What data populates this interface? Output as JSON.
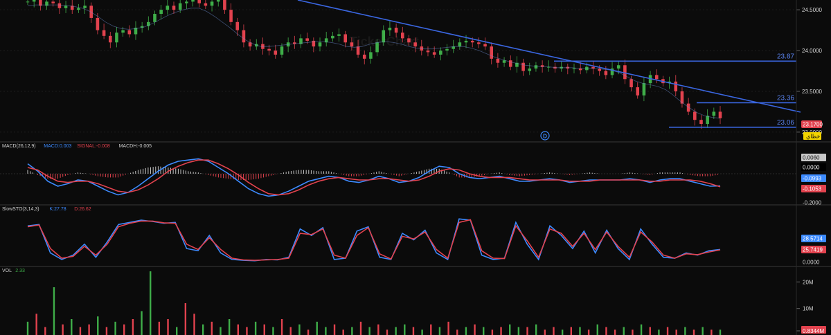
{
  "watermark": "TickerChart",
  "event_marker": "D",
  "chart_data": [
    {
      "type": "candlestick",
      "name": "price",
      "yticks": [
        "24.5000",
        "24.0000",
        "23.5000",
        "23.0000"
      ],
      "ylim": [
        22.88,
        24.62
      ],
      "last_price": "23.1700",
      "badge_text": "خطاي",
      "horizontal_lines": [
        {
          "label": "23.87",
          "value": 23.87
        },
        {
          "label": "23.36",
          "value": 23.36
        },
        {
          "label": "23.06",
          "value": 23.06
        }
      ],
      "closes": [
        24.6,
        24.62,
        24.55,
        24.6,
        24.58,
        24.52,
        24.55,
        24.5,
        24.52,
        24.55,
        24.4,
        24.25,
        24.18,
        24.1,
        24.22,
        24.25,
        24.2,
        24.28,
        24.3,
        24.35,
        24.45,
        24.5,
        24.55,
        24.5,
        24.58,
        24.6,
        24.62,
        24.58,
        24.55,
        24.6,
        24.62,
        24.5,
        24.35,
        24.25,
        24.1,
        24.05,
        24.08,
        24.02,
        24.0,
        23.95,
        24.05,
        24.1,
        24.08,
        24.15,
        24.12,
        24.05,
        24.1,
        24.15,
        24.18,
        24.2,
        24.1,
        24.05,
        23.95,
        23.9,
        23.98,
        24.1,
        24.25,
        24.28,
        24.22,
        24.15,
        24.1,
        24.05,
        24.0,
        23.98,
        23.95,
        24.0,
        24.02,
        24.05,
        24.1,
        24.12,
        24.1,
        24.08,
        24.05,
        23.9,
        23.85,
        23.88,
        23.8,
        23.85,
        23.75,
        23.78,
        23.82,
        23.8,
        23.8,
        23.78,
        23.8,
        23.78,
        23.78,
        23.76,
        23.8,
        23.78,
        23.75,
        23.7,
        23.78,
        23.82,
        23.65,
        23.55,
        23.45,
        23.6,
        23.7,
        23.65,
        23.6,
        23.62,
        23.5,
        23.35,
        23.25,
        23.15,
        23.1,
        23.2,
        23.25,
        23.17
      ],
      "ma": [
        24.55,
        24.56,
        24.56,
        24.56,
        24.56,
        24.55,
        24.54,
        24.52,
        24.48,
        24.42,
        24.35,
        24.3,
        24.27,
        24.26,
        24.27,
        24.29,
        24.33,
        24.38,
        24.43,
        24.47,
        24.5,
        24.52,
        24.52,
        24.48,
        24.42,
        24.35,
        24.28,
        24.2,
        24.13,
        24.08,
        24.05,
        24.05,
        24.06,
        24.07,
        24.08,
        24.09,
        24.1,
        24.11,
        24.11,
        24.1,
        24.08,
        24.05,
        24.04,
        24.05,
        24.08,
        24.1,
        24.11,
        24.1,
        24.08,
        24.05,
        24.03,
        24.02,
        24.02,
        24.03,
        24.04,
        24.05,
        24.05,
        24.03,
        24.0,
        23.96,
        23.92,
        23.89,
        23.86,
        23.84,
        23.82,
        23.81,
        23.8,
        23.8,
        23.79,
        23.79,
        23.79,
        23.78,
        23.78,
        23.78,
        23.77,
        23.76,
        23.73,
        23.68,
        23.63,
        23.6,
        23.58,
        23.56,
        23.52,
        23.45,
        23.37,
        23.3,
        23.24,
        23.2,
        23.18,
        23.17
      ]
    },
    {
      "type": "bar+line",
      "name": "MACD(26,12,9)",
      "legend": [
        {
          "label": "MACD(26,12,9)",
          "color": "#d0d0d0"
        },
        {
          "label": "MACD:0.003",
          "color": "#3d8bff"
        },
        {
          "label": "SIGNAL:-0.008",
          "color": "#e2424e"
        },
        {
          "label": "MACDH:-0.005",
          "color": "#d0d0d0"
        }
      ],
      "yticks": [
        "0.0060",
        "0.0000",
        "-0.0993",
        "-0.1053",
        "-0.2000"
      ],
      "ylim": [
        -0.22,
        0.12
      ],
      "macd": [
        0.08,
        0.02,
        -0.06,
        -0.1,
        -0.08,
        -0.05,
        -0.06,
        -0.1,
        -0.14,
        -0.17,
        -0.15,
        -0.1,
        -0.04,
        0.02,
        0.07,
        0.1,
        0.11,
        0.12,
        0.1,
        0.05,
        0.0,
        -0.06,
        -0.12,
        -0.16,
        -0.18,
        -0.17,
        -0.14,
        -0.1,
        -0.06,
        -0.04,
        -0.02,
        -0.03,
        -0.06,
        -0.07,
        -0.05,
        -0.02,
        -0.04,
        -0.07,
        -0.06,
        -0.03,
        0.02,
        0.06,
        0.05,
        0.0,
        -0.03,
        -0.04,
        -0.03,
        -0.02,
        -0.04,
        -0.06,
        -0.06,
        -0.05,
        -0.04,
        -0.05,
        -0.07,
        -0.06,
        -0.05,
        -0.05,
        -0.05,
        -0.05,
        -0.04,
        -0.05,
        -0.07,
        -0.05,
        -0.04,
        -0.04,
        -0.06,
        -0.08,
        -0.1,
        -0.098
      ],
      "signal": [
        0.05,
        0.03,
        -0.02,
        -0.06,
        -0.07,
        -0.06,
        -0.06,
        -0.08,
        -0.11,
        -0.14,
        -0.15,
        -0.13,
        -0.09,
        -0.04,
        0.02,
        0.06,
        0.09,
        0.11,
        0.11,
        0.08,
        0.04,
        -0.01,
        -0.07,
        -0.12,
        -0.16,
        -0.17,
        -0.16,
        -0.13,
        -0.09,
        -0.06,
        -0.04,
        -0.03,
        -0.04,
        -0.05,
        -0.05,
        -0.04,
        -0.04,
        -0.05,
        -0.06,
        -0.05,
        -0.02,
        0.02,
        0.04,
        0.03,
        0.0,
        -0.02,
        -0.03,
        -0.03,
        -0.03,
        -0.04,
        -0.05,
        -0.05,
        -0.05,
        -0.05,
        -0.06,
        -0.06,
        -0.06,
        -0.05,
        -0.05,
        -0.05,
        -0.05,
        -0.05,
        -0.06,
        -0.06,
        -0.05,
        -0.05,
        -0.05,
        -0.06,
        -0.08,
        -0.105
      ],
      "hist": [
        0.03,
        -0.01,
        -0.04,
        -0.04,
        -0.01,
        0.01,
        0.0,
        -0.02,
        -0.03,
        -0.03,
        0.0,
        0.03,
        0.05,
        0.06,
        0.05,
        0.04,
        0.02,
        0.01,
        -0.01,
        -0.03,
        -0.04,
        -0.05,
        -0.05,
        -0.04,
        -0.02,
        0.0,
        0.02,
        0.03,
        0.03,
        0.02,
        0.02,
        0.0,
        -0.02,
        -0.02,
        0.0,
        0.02,
        0.0,
        -0.02,
        0.0,
        0.02,
        0.04,
        0.04,
        0.01,
        -0.03,
        -0.03,
        -0.02,
        0.0,
        0.01,
        -0.01,
        -0.02,
        -0.01,
        0.0,
        0.01,
        0.0,
        -0.01,
        0.0,
        0.01,
        0.0,
        0.0,
        0.0,
        0.01,
        0.0,
        -0.01,
        0.01,
        0.01,
        0.01,
        -0.01,
        -0.02,
        -0.02,
        -0.005
      ]
    },
    {
      "type": "line",
      "name": "SlowSTO(3,14,3)",
      "legend": [
        {
          "label": "SlowSTO(3,14,3)",
          "color": "#d0d0d0"
        },
        {
          "label": "K:27.78",
          "color": "#3d8bff"
        },
        {
          "label": "D:26.62",
          "color": "#e2424e"
        }
      ],
      "yticks": [
        "28.5714",
        "25.7419",
        "0.0000"
      ],
      "ylim": [
        0,
        100
      ],
      "k": [
        82,
        85,
        20,
        5,
        15,
        40,
        10,
        45,
        85,
        90,
        95,
        92,
        88,
        90,
        30,
        25,
        60,
        20,
        5,
        3,
        2,
        5,
        4,
        10,
        75,
        60,
        78,
        5,
        8,
        70,
        80,
        10,
        5,
        65,
        50,
        72,
        20,
        5,
        98,
        95,
        15,
        5,
        8,
        90,
        40,
        5,
        82,
        60,
        30,
        70,
        20,
        72,
        30,
        5,
        75,
        40,
        10,
        8,
        20,
        15,
        25,
        28
      ],
      "d": [
        80,
        84,
        30,
        8,
        12,
        35,
        15,
        40,
        80,
        88,
        93,
        93,
        89,
        88,
        40,
        28,
        55,
        28,
        8,
        4,
        3,
        4,
        5,
        8,
        65,
        62,
        75,
        15,
        8,
        60,
        78,
        18,
        6,
        58,
        52,
        68,
        28,
        8,
        90,
        96,
        25,
        8,
        7,
        82,
        48,
        10,
        75,
        65,
        35,
        65,
        28,
        68,
        35,
        10,
        68,
        45,
        15,
        8,
        18,
        16,
        22,
        27
      ]
    },
    {
      "type": "bar",
      "name": "VOL",
      "legend": [
        {
          "label": "VOL",
          "color": "#d0d0d0"
        },
        {
          "label": "2.33",
          "color": "#3fae49"
        }
      ],
      "yticks": [
        "20M",
        "10M",
        "0.8344M"
      ],
      "ylim": [
        0,
        24
      ],
      "values": [
        5,
        8,
        3,
        18,
        4,
        6,
        3,
        4,
        7,
        3,
        5,
        4,
        6,
        9,
        24,
        5,
        6,
        3,
        12,
        8,
        4,
        5,
        3,
        6,
        4,
        3,
        5,
        4,
        3,
        6,
        3,
        4,
        2,
        5,
        3,
        4,
        2,
        3,
        5,
        3,
        4,
        2,
        3,
        4,
        3,
        2,
        4,
        3,
        5,
        2,
        3,
        4,
        3,
        2,
        3,
        4,
        3,
        3,
        4,
        2,
        3,
        2,
        3,
        3,
        2,
        4,
        3,
        2,
        3,
        2,
        4,
        3,
        2,
        3,
        2,
        3,
        2,
        3,
        2,
        2
      ],
      "up": [
        1,
        0,
        0,
        1,
        0,
        1,
        0,
        0,
        1,
        0,
        1,
        0,
        0,
        1,
        1,
        0,
        0,
        1,
        0,
        0,
        1,
        0,
        1,
        1,
        0,
        0,
        1,
        0,
        1,
        0,
        0,
        1,
        0,
        1,
        1,
        0,
        0,
        1,
        0,
        1,
        0,
        0,
        1,
        1,
        0,
        1,
        0,
        1,
        0,
        0,
        1,
        0,
        1,
        0,
        0,
        1,
        1,
        0,
        1,
        0,
        0,
        1,
        0,
        1,
        0,
        1,
        0,
        0,
        1,
        0,
        1,
        0,
        1,
        0,
        0,
        1,
        0,
        1,
        0,
        1
      ]
    }
  ]
}
